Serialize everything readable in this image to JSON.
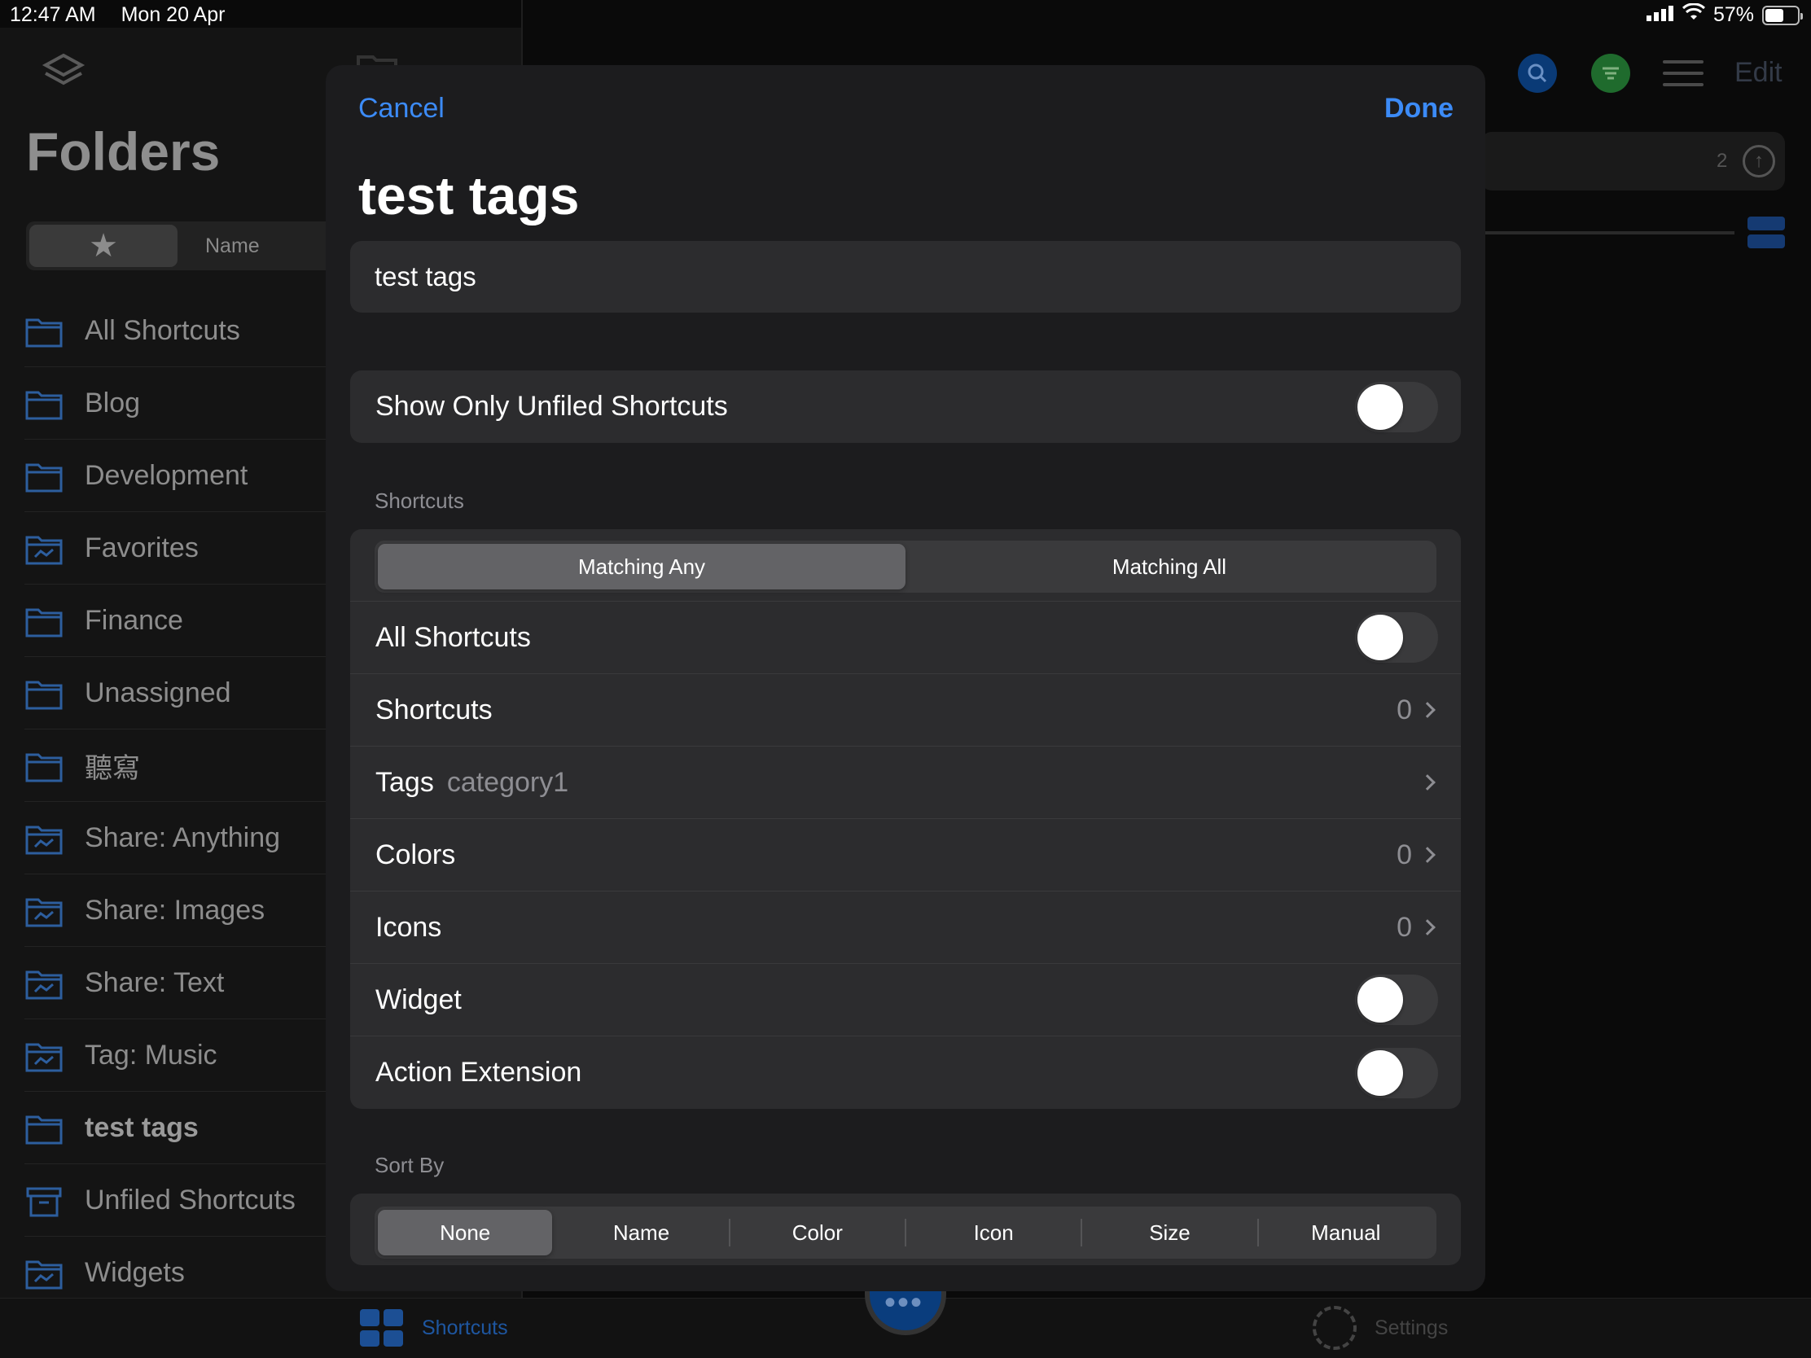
{
  "status_bar": {
    "time": "12:47 AM",
    "date": "Mon 20 Apr",
    "battery": "57%",
    "battery_level": 0.57
  },
  "sidebar": {
    "title": "Folders",
    "sort_segment": {
      "favorites_icon": "star-icon",
      "name_label": "Name"
    },
    "folders": [
      {
        "label": "All Shortcuts",
        "icon": "folder-icon"
      },
      {
        "label": "Blog",
        "icon": "folder-icon"
      },
      {
        "label": "Development",
        "icon": "folder-icon"
      },
      {
        "label": "Favorites",
        "icon": "smart-folder-icon"
      },
      {
        "label": "Finance",
        "icon": "folder-icon"
      },
      {
        "label": "Unassigned",
        "icon": "folder-icon"
      },
      {
        "label": "聽寫",
        "icon": "folder-icon"
      },
      {
        "label": "Share: Anything",
        "icon": "smart-folder-icon"
      },
      {
        "label": "Share: Images",
        "icon": "smart-folder-icon"
      },
      {
        "label": "Share: Text",
        "icon": "smart-folder-icon"
      },
      {
        "label": "Tag: Music",
        "icon": "smart-folder-icon"
      },
      {
        "label": "test tags",
        "icon": "folder-icon",
        "active": true
      },
      {
        "label": "Unfiled Shortcuts",
        "icon": "archive-icon"
      },
      {
        "label": "Widgets",
        "icon": "smart-folder-icon"
      }
    ]
  },
  "background_toolbar": {
    "edit_label": "Edit",
    "count": "2"
  },
  "tabbar": {
    "shortcuts_label": "Shortcuts",
    "settings_label": "Settings"
  },
  "modal": {
    "cancel_label": "Cancel",
    "done_label": "Done",
    "title": "test tags",
    "name_value": "test tags",
    "show_unfiled": {
      "label": "Show Only Unfiled Shortcuts",
      "on": false
    },
    "shortcuts_section": {
      "header": "Shortcuts",
      "match_options": [
        "Matching Any",
        "Matching All"
      ],
      "match_selected": "Matching Any",
      "all_shortcuts": {
        "label": "All Shortcuts",
        "on": false
      },
      "shortcuts": {
        "label": "Shortcuts",
        "value": "0"
      },
      "tags": {
        "label": "Tags",
        "value": "category1"
      },
      "colors": {
        "label": "Colors",
        "value": "0"
      },
      "icons": {
        "label": "Icons",
        "value": "0"
      },
      "widget": {
        "label": "Widget",
        "on": false
      },
      "action_extension": {
        "label": "Action Extension",
        "on": false
      }
    },
    "sort_section": {
      "header": "Sort By",
      "options": [
        "None",
        "Name",
        "Color",
        "Icon",
        "Size",
        "Manual"
      ],
      "selected": "None"
    }
  },
  "colors": {
    "accent": "#3c8bf7",
    "sheet_bg": "#1c1c1e",
    "row_bg": "#2c2c2e"
  }
}
